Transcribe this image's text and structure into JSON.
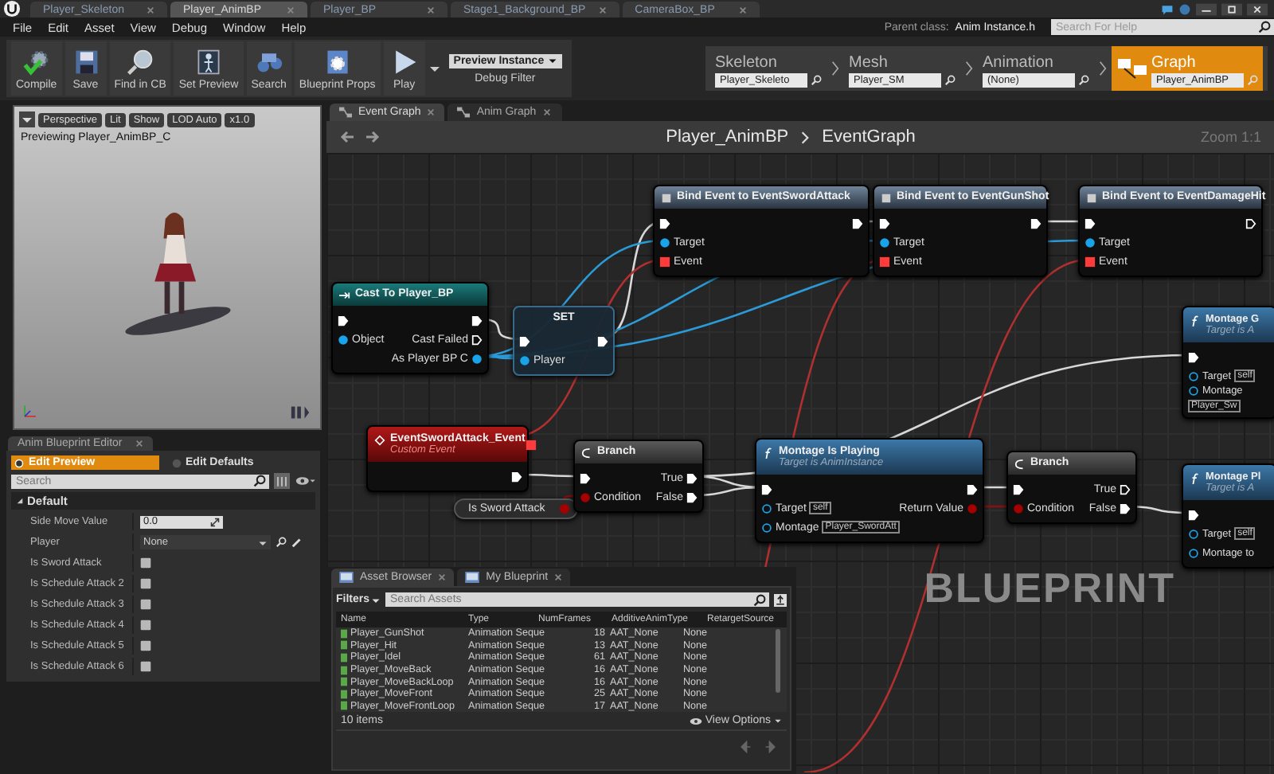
{
  "window": {
    "tabs": [
      {
        "label": "Player_Skeleton",
        "selected": false
      },
      {
        "label": "Player_AnimBP",
        "selected": true
      },
      {
        "label": "Player_BP",
        "selected": false
      },
      {
        "label": "Stage1_Background_BP",
        "selected": false
      },
      {
        "label": "CameraBox_BP",
        "selected": false
      }
    ]
  },
  "menu": [
    "File",
    "Edit",
    "Asset",
    "View",
    "Debug",
    "Window",
    "Help"
  ],
  "help": {
    "parent_label": "Parent class:",
    "parent_value": "Anim Instance.h",
    "search_placeholder": "Search For Help"
  },
  "toolbar": {
    "buttons": [
      {
        "label": "Compile",
        "kind": "compile"
      },
      {
        "label": "Save",
        "kind": "save"
      },
      {
        "label": "Find in CB",
        "kind": "find"
      },
      {
        "label": "Set Preview",
        "kind": "preview"
      },
      {
        "label": "Search",
        "kind": "search"
      },
      {
        "label": "Blueprint Props",
        "kind": "props"
      },
      {
        "label": "Play",
        "kind": "play"
      }
    ],
    "debug_value": "Preview Instance",
    "debug_label": "Debug Filter"
  },
  "modes": [
    {
      "label": "Skeleton",
      "value": "Player_Skeleto",
      "selected": false
    },
    {
      "label": "Mesh",
      "value": "Player_SM",
      "selected": false
    },
    {
      "label": "Animation",
      "value": "(None)",
      "selected": false
    },
    {
      "label": "Graph",
      "value": "Player_AnimBP",
      "selected": true
    }
  ],
  "viewport": {
    "buttons": [
      "Perspective",
      "Lit",
      "Show",
      "LOD Auto",
      "x1.0"
    ],
    "caption": "Previewing Player_AnimBP_C"
  },
  "details": {
    "tab": "Anim Blueprint Editor",
    "views": [
      {
        "label": "Edit Preview",
        "selected": true
      },
      {
        "label": "Edit Defaults",
        "selected": false
      }
    ],
    "search_placeholder": "Search",
    "category": "Default",
    "properties": [
      {
        "label": "Side Move Value",
        "kind": "number",
        "value": "0.0"
      },
      {
        "label": "Player",
        "kind": "object",
        "value": "None"
      },
      {
        "label": "Is Sword Attack",
        "kind": "checkbox",
        "checked": false
      },
      {
        "label": "Is Schedule Attack 2",
        "kind": "checkbox",
        "checked": false
      },
      {
        "label": "Is Schedule Attack 3",
        "kind": "checkbox",
        "checked": false
      },
      {
        "label": "Is Schedule Attack 4",
        "kind": "checkbox",
        "checked": false
      },
      {
        "label": "Is Schedule Attack 5",
        "kind": "checkbox",
        "checked": false
      },
      {
        "label": "Is Schedule Attack 6",
        "kind": "checkbox",
        "checked": false
      }
    ]
  },
  "graph": {
    "tabs": [
      {
        "label": "Event Graph",
        "selected": true
      },
      {
        "label": "Anim Graph",
        "selected": false
      }
    ],
    "breadcrumb": [
      "Player_AnimBP",
      "EventGraph"
    ],
    "zoom": "Zoom 1:1",
    "watermark": "BLUEPRINT",
    "nodes": [
      {
        "kind": "bind",
        "title": "Bind Event to EventSwordAttack",
        "rows": [
          {
            "left": {
              "kind": "exec",
              "connected": true
            },
            "right": {
              "kind": "exec",
              "connected": true
            }
          },
          {
            "left": {
              "kind": "object",
              "label": "Target",
              "connected": true
            }
          },
          {
            "left": {
              "kind": "delegate",
              "label": "Event",
              "connected": true
            }
          }
        ]
      },
      {
        "kind": "bind",
        "title": "Bind Event to EventGunShot",
        "rows": [
          {
            "left": {
              "kind": "exec",
              "connected": true
            },
            "right": {
              "kind": "exec",
              "connected": true
            }
          },
          {
            "left": {
              "kind": "object",
              "label": "Target",
              "connected": true
            }
          },
          {
            "left": {
              "kind": "delegate",
              "label": "Event",
              "connected": true
            }
          }
        ]
      },
      {
        "kind": "bind",
        "title": "Bind Event to EventDamageHit",
        "rows": [
          {
            "left": {
              "kind": "exec",
              "connected": true
            },
            "right": {
              "kind": "exec",
              "connected": false
            }
          },
          {
            "left": {
              "kind": "object",
              "label": "Target",
              "connected": true
            }
          },
          {
            "left": {
              "kind": "delegate",
              "label": "Event",
              "connected": true
            }
          }
        ]
      },
      {
        "kind": "cast",
        "title": "Cast To Player_BP",
        "rows": [
          {
            "left": {
              "kind": "exec",
              "connected": true
            },
            "right": {
              "kind": "exec",
              "connected": true
            }
          },
          {
            "left": {
              "kind": "object",
              "label": "Object",
              "connected": true
            },
            "right": {
              "kind": "exec",
              "label": "Cast Failed",
              "connected": false
            }
          },
          {
            "right": {
              "kind": "object",
              "label": "As Player BP C",
              "connected": true
            }
          }
        ]
      },
      {
        "kind": "set",
        "title": "SET",
        "rows": [
          {
            "left": {
              "kind": "exec",
              "connected": true
            },
            "right": {
              "kind": "exec",
              "connected": true
            }
          },
          {
            "left": {
              "kind": "object",
              "label": "Player",
              "connected": true
            }
          }
        ]
      },
      {
        "kind": "event",
        "title": "EventSwordAttack_Event",
        "subtitle": "Custom Event",
        "header_pin": {
          "kind": "delegate",
          "connected": true
        },
        "rows": [
          {
            "right": {
              "kind": "exec",
              "connected": true
            }
          }
        ]
      },
      {
        "kind": "variable",
        "title": "Is Sword Attack",
        "header_pin": {
          "kind": "bool",
          "connected": true
        }
      },
      {
        "kind": "branch",
        "title": "Branch",
        "rows": [
          {
            "left": {
              "kind": "exec",
              "connected": true
            },
            "right": {
              "kind": "exec",
              "label": "True",
              "connected": true
            }
          },
          {
            "left": {
              "kind": "bool",
              "label": "Condition",
              "connected": true
            },
            "right": {
              "kind": "exec",
              "label": "False",
              "connected": true
            }
          }
        ]
      },
      {
        "kind": "function",
        "title": "Montage Is Playing",
        "subtitle": "Target is AnimInstance",
        "rows": [
          {
            "left": {
              "kind": "exec",
              "connected": true
            },
            "right": {
              "kind": "exec",
              "connected": true
            }
          },
          {
            "left": {
              "kind": "object",
              "label": "Target",
              "value": "self",
              "connected": false
            },
            "right": {
              "kind": "bool",
              "label": "Return Value",
              "connected": true
            }
          },
          {
            "left": {
              "kind": "object",
              "label": "Montage",
              "value": "Player_SwordAtt",
              "connected": false
            }
          }
        ]
      },
      {
        "kind": "branch",
        "title": "Branch",
        "rows": [
          {
            "left": {
              "kind": "exec",
              "connected": true
            },
            "right": {
              "kind": "exec",
              "label": "True",
              "connected": false
            }
          },
          {
            "left": {
              "kind": "bool",
              "label": "Condition",
              "connected": true
            },
            "right": {
              "kind": "exec",
              "label": "False",
              "connected": true
            }
          }
        ]
      },
      {
        "kind": "function",
        "title": "Montage G",
        "subtitle": "Target is A",
        "rows": [
          {
            "left": {
              "kind": "exec",
              "connected": true
            }
          },
          {
            "left": {
              "kind": "object",
              "label": "Target",
              "value": "self",
              "connected": false
            }
          },
          {
            "left": {
              "kind": "object",
              "label": "Montage",
              "value": "Player_Sw",
              "connected": false
            }
          }
        ]
      },
      {
        "kind": "function",
        "title": "Montage Pl",
        "subtitle": "Target is A",
        "rows": [
          {
            "left": {
              "kind": "exec",
              "connected": true
            }
          },
          {
            "left": {
              "kind": "object",
              "label": "Target",
              "value": "self",
              "connected": false
            }
          },
          {
            "left": {
              "kind": "object",
              "label": "Montage to",
              "connected": false
            }
          }
        ]
      }
    ]
  },
  "asset_browser": {
    "tabs": [
      {
        "label": "Asset Browser",
        "selected": true
      },
      {
        "label": "My Blueprint",
        "selected": false
      }
    ],
    "filters": "Filters",
    "search_placeholder": "Search Assets",
    "columns": [
      "Name",
      "Type",
      "NumFrames",
      "AdditiveAnimType",
      "RetargetSource"
    ],
    "rows": [
      [
        "Player_GunShot",
        "Animation Seque",
        "18",
        "AAT_None",
        "None"
      ],
      [
        "Player_Hit",
        "Animation Seque",
        "13",
        "AAT_None",
        "None"
      ],
      [
        "Player_Idel",
        "Animation Seque",
        "61",
        "AAT_None",
        "None"
      ],
      [
        "Player_MoveBack",
        "Animation Seque",
        "16",
        "AAT_None",
        "None"
      ],
      [
        "Player_MoveBackLoop",
        "Animation Seque",
        "16",
        "AAT_None",
        "None"
      ],
      [
        "Player_MoveFront",
        "Animation Seque",
        "25",
        "AAT_None",
        "None"
      ],
      [
        "Player_MoveFrontLoop",
        "Animation Seque",
        "17",
        "AAT_None",
        "None"
      ]
    ],
    "count": "10 items",
    "view_options": "View Options"
  }
}
